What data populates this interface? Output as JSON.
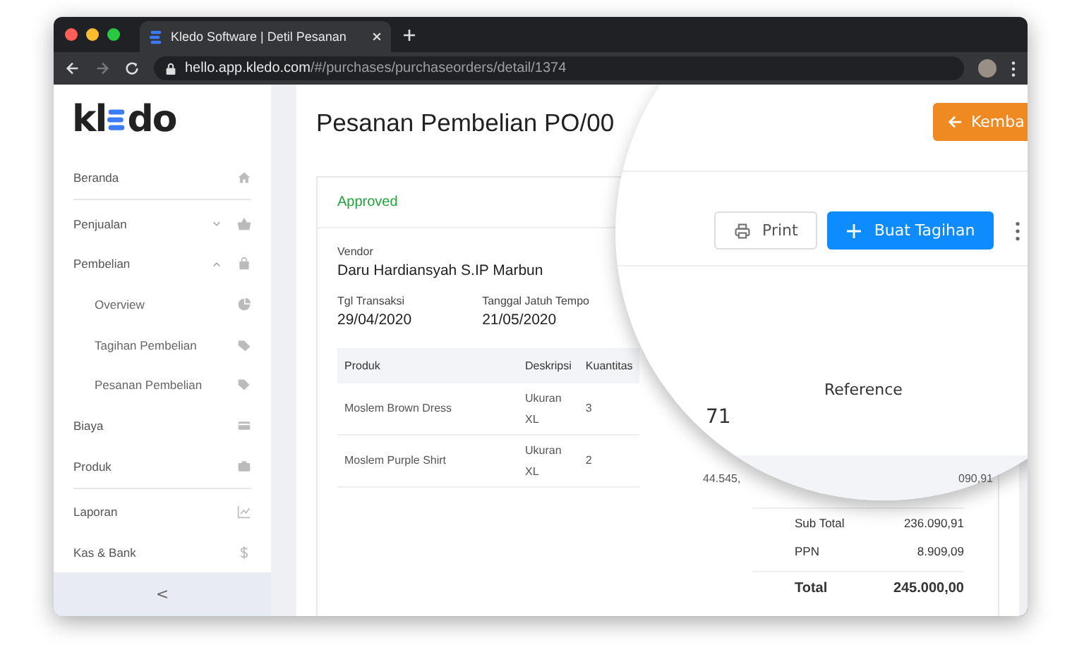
{
  "browser": {
    "tab_title": "Kledo Software | Detil Pesanan",
    "url_host": "hello.app.kledo.com",
    "url_path": "/#/purchases/purchaseorders/detail/1374"
  },
  "sidebar": {
    "logo": {
      "before": "kl",
      "after": "do"
    },
    "sections": [
      [
        {
          "label": "Beranda"
        }
      ],
      [
        {
          "label": "Penjualan",
          "expanded": false
        },
        {
          "label": "Pembelian",
          "expanded": true,
          "children": [
            {
              "label": "Overview"
            },
            {
              "label": "Tagihan Pembelian"
            },
            {
              "label": "Pesanan Pembelian"
            }
          ]
        },
        {
          "label": "Biaya"
        },
        {
          "label": "Produk"
        }
      ],
      [
        {
          "label": "Laporan"
        },
        {
          "label": "Kas & Bank"
        }
      ]
    ],
    "collapse": "<"
  },
  "page": {
    "title": "Pesanan Pembelian PO/00",
    "status": "Approved",
    "vendor_label": "Vendor",
    "vendor": "Daru Hardiansyah S.IP Marbun",
    "fields": [
      {
        "label": "Tgl Transaksi",
        "value": "29/04/2020"
      },
      {
        "label": "Tanggal Jatuh Tempo",
        "value": "21/05/2020"
      }
    ],
    "table": {
      "columns": [
        "Produk",
        "Deskripsi",
        "Kuantitas"
      ],
      "rows": [
        [
          "Moslem Brown Dress",
          "Ukuran XL",
          "3"
        ],
        [
          "Moslem Purple Shirt",
          "Ukuran XL",
          "2"
        ]
      ]
    },
    "totals": [
      {
        "label": "Sub Total",
        "value": "236.090,91",
        "strong": false
      },
      {
        "label": "PPN",
        "value": "8.909,09",
        "strong": false
      },
      {
        "label": "Total",
        "value": "245.000,00",
        "strong": true
      }
    ]
  },
  "lens": {
    "back_button": "Kemba",
    "print_button": "Print",
    "create_button": "Buat Tagihan",
    "reference_label": "Reference",
    "fragment": "71",
    "row_price": "44.545,",
    "row_amount": "090,91"
  }
}
